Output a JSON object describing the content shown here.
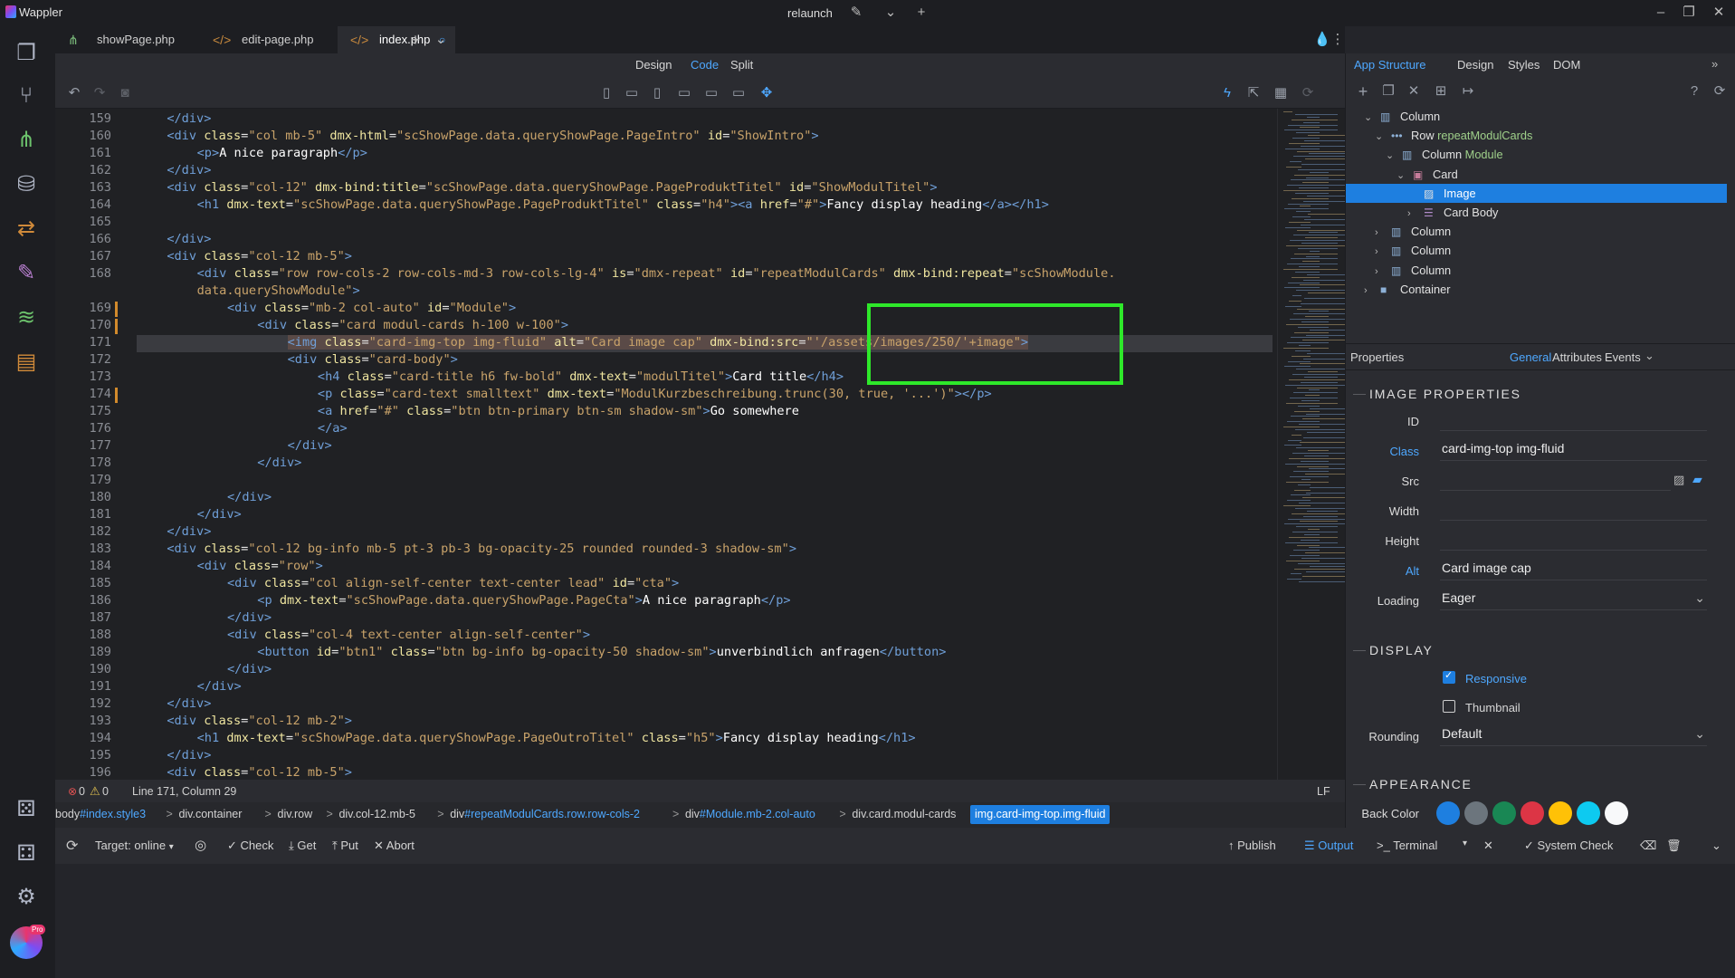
{
  "app": {
    "name": "Wappler",
    "project": "relaunch"
  },
  "tabs": [
    {
      "label": "showPage.php",
      "active": false
    },
    {
      "label": "edit-page.php",
      "active": false
    },
    {
      "label": "index.php",
      "active": true
    }
  ],
  "modes": {
    "design": "Design",
    "code": "Code",
    "split": "Split",
    "active": "Code"
  },
  "code_lines": [
    {
      "n": "159",
      "indent": 4,
      "html": "<span class='tg'>&lt;/div&gt;</span>"
    },
    {
      "n": "160",
      "indent": 4,
      "html": "<span class='tg'>&lt;div</span> <span class='at'>class</span>=<span class='sv'>\"col mb-5\"</span> <span class='at'>dmx-html</span>=<span class='sv'>\"scShowPage.data.queryShowPage.PageIntro\"</span> <span class='at'>id</span>=<span class='sv'>\"ShowIntro\"</span><span class='tg'>&gt;</span>"
    },
    {
      "n": "161",
      "indent": 8,
      "html": "<span class='tg'>&lt;p&gt;</span><span class='tx'>A nice paragraph</span><span class='tg'>&lt;/p&gt;</span>"
    },
    {
      "n": "162",
      "indent": 4,
      "html": "<span class='tg'>&lt;/div&gt;</span>"
    },
    {
      "n": "163",
      "indent": 4,
      "html": "<span class='tg'>&lt;div</span> <span class='at'>class</span>=<span class='sv'>\"col-12\"</span> <span class='at'>dmx-bind:title</span>=<span class='sv'>\"scShowPage.data.queryShowPage.PageProduktTitel\"</span> <span class='at'>id</span>=<span class='sv'>\"ShowModulTitel\"</span><span class='tg'>&gt;</span>"
    },
    {
      "n": "164",
      "indent": 8,
      "html": "<span class='tg'>&lt;h1</span> <span class='at'>dmx-text</span>=<span class='sv'>\"scShowPage.data.queryShowPage.PageProduktTitel\"</span> <span class='at'>class</span>=<span class='sv'>\"h4\"</span><span class='tg'>&gt;&lt;a</span> <span class='at'>href</span>=<span class='sv'>\"#\"</span><span class='tg'>&gt;</span><span class='tx'>Fancy display heading</span><span class='tg'>&lt;/a&gt;&lt;/h1&gt;</span>"
    },
    {
      "n": "165",
      "indent": 0,
      "html": ""
    },
    {
      "n": "166",
      "indent": 4,
      "html": "<span class='tg'>&lt;/div&gt;</span>"
    },
    {
      "n": "167",
      "indent": 4,
      "html": "<span class='tg'>&lt;div</span> <span class='at'>class</span>=<span class='sv'>\"col-12 mb-5\"</span><span class='tg'>&gt;</span>"
    },
    {
      "n": "168",
      "indent": 8,
      "html": "<span class='tg'>&lt;div</span> <span class='at'>class</span>=<span class='sv'>\"row row-cols-2 row-cols-md-3 row-cols-lg-4\"</span> <span class='at'>is</span>=<span class='sv'>\"dmx-repeat\"</span> <span class='at'>id</span>=<span class='sv'>\"repeatModulCards\"</span> <span class='at'>dmx-bind:repeat</span>=<span class='sv'>\"scShowModule.</span>"
    },
    {
      "n": "",
      "indent": 8,
      "html": "<span class='sv'>data.queryShowModule\"</span><span class='tg'>&gt;</span>"
    },
    {
      "n": "169",
      "indent": 12,
      "mod": true,
      "html": "<span class='tg'>&lt;div</span> <span class='at'>class</span>=<span class='sv'>\"mb-2 col-auto\"</span> <span class='at'>id</span>=<span class='sv'>\"Module\"</span><span class='tg'>&gt;</span>"
    },
    {
      "n": "170",
      "indent": 16,
      "mod": true,
      "html": "<span class='tg'>&lt;div</span> <span class='at'>class</span>=<span class='sv'>\"card modul-cards h-100 w-100\"</span><span class='tg'>&gt;</span>"
    },
    {
      "n": "171",
      "indent": 20,
      "current": true,
      "html": "<span class='sel'><span class='tg'>&lt;img</span> <span class='at'>class</span>=<span class='sv'>\"card-img-top img-fluid\"</span> <span class='at'>alt</span>=<span class='sv'>\"Card image cap\"</span> <span class='at'>dmx-bind:src</span>=<span class='sv'>\"'/assets/images/250/'+image\"</span><span class='tg'>&gt;</span></span>"
    },
    {
      "n": "172",
      "indent": 20,
      "html": "<span class='tg'>&lt;div</span> <span class='at'>class</span>=<span class='sv'>\"card-body\"</span><span class='tg'>&gt;</span>"
    },
    {
      "n": "173",
      "indent": 24,
      "html": "<span class='tg'>&lt;h4</span> <span class='at'>class</span>=<span class='sv'>\"card-title h6 fw-bold\"</span> <span class='at'>dmx-text</span>=<span class='sv'>\"modulTitel\"</span><span class='tg'>&gt;</span><span class='tx'>Card title</span><span class='tg'>&lt;/h4&gt;</span>"
    },
    {
      "n": "174",
      "indent": 24,
      "mod": true,
      "html": "<span class='tg'>&lt;p</span> <span class='at'>class</span>=<span class='sv'>\"card-text smalltext\"</span> <span class='at'>dmx-text</span>=<span class='sv'>\"ModulKurzbeschreibung.trunc(30, true, '...')\"</span><span class='tg'>&gt;&lt;/p&gt;</span>"
    },
    {
      "n": "175",
      "indent": 24,
      "html": "<span class='tg'>&lt;a</span> <span class='at'>href</span>=<span class='sv'>\"#\"</span> <span class='at'>class</span>=<span class='sv'>\"btn btn-primary btn-sm shadow-sm\"</span><span class='tg'>&gt;</span><span class='tx'>Go somewhere</span>"
    },
    {
      "n": "176",
      "indent": 24,
      "html": "<span class='tg'>&lt;/a&gt;</span>"
    },
    {
      "n": "177",
      "indent": 20,
      "html": "<span class='tg'>&lt;/div&gt;</span>"
    },
    {
      "n": "178",
      "indent": 16,
      "html": "<span class='tg'>&lt;/div&gt;</span>"
    },
    {
      "n": "179",
      "indent": 0,
      "html": ""
    },
    {
      "n": "180",
      "indent": 12,
      "html": "<span class='tg'>&lt;/div&gt;</span>"
    },
    {
      "n": "181",
      "indent": 8,
      "html": "<span class='tg'>&lt;/div&gt;</span>"
    },
    {
      "n": "182",
      "indent": 4,
      "html": "<span class='tg'>&lt;/div&gt;</span>"
    },
    {
      "n": "183",
      "indent": 4,
      "html": "<span class='tg'>&lt;div</span> <span class='at'>class</span>=<span class='sv'>\"col-12 bg-info mb-5 pt-3 pb-3 bg-opacity-25 rounded rounded-3 shadow-sm\"</span><span class='tg'>&gt;</span>"
    },
    {
      "n": "184",
      "indent": 8,
      "html": "<span class='tg'>&lt;div</span> <span class='at'>class</span>=<span class='sv'>\"row\"</span><span class='tg'>&gt;</span>"
    },
    {
      "n": "185",
      "indent": 12,
      "html": "<span class='tg'>&lt;div</span> <span class='at'>class</span>=<span class='sv'>\"col align-self-center text-center lead\"</span> <span class='at'>id</span>=<span class='sv'>\"cta\"</span><span class='tg'>&gt;</span>"
    },
    {
      "n": "186",
      "indent": 16,
      "html": "<span class='tg'>&lt;p</span> <span class='at'>dmx-text</span>=<span class='sv'>\"scShowPage.data.queryShowPage.PageCta\"</span><span class='tg'>&gt;</span><span class='tx'>A nice paragraph</span><span class='tg'>&lt;/p&gt;</span>"
    },
    {
      "n": "187",
      "indent": 12,
      "html": "<span class='tg'>&lt;/div&gt;</span>"
    },
    {
      "n": "188",
      "indent": 12,
      "html": "<span class='tg'>&lt;div</span> <span class='at'>class</span>=<span class='sv'>\"col-4 text-center align-self-center\"</span><span class='tg'>&gt;</span>"
    },
    {
      "n": "189",
      "indent": 16,
      "html": "<span class='tg'>&lt;button</span> <span class='at'>id</span>=<span class='sv'>\"btn1\"</span> <span class='at'>class</span>=<span class='sv'>\"btn bg-info bg-opacity-50 shadow-sm\"</span><span class='tg'>&gt;</span><span class='tx'>unverbindlich anfragen</span><span class='tg'>&lt;/button&gt;</span>"
    },
    {
      "n": "190",
      "indent": 12,
      "html": "<span class='tg'>&lt;/div&gt;</span>"
    },
    {
      "n": "191",
      "indent": 8,
      "html": "<span class='tg'>&lt;/div&gt;</span>"
    },
    {
      "n": "192",
      "indent": 4,
      "html": "<span class='tg'>&lt;/div&gt;</span>"
    },
    {
      "n": "193",
      "indent": 4,
      "html": "<span class='tg'>&lt;div</span> <span class='at'>class</span>=<span class='sv'>\"col-12 mb-2\"</span><span class='tg'>&gt;</span>"
    },
    {
      "n": "194",
      "indent": 8,
      "html": "<span class='tg'>&lt;h1</span> <span class='at'>dmx-text</span>=<span class='sv'>\"scShowPage.data.queryShowPage.PageOutroTitel\"</span> <span class='at'>class</span>=<span class='sv'>\"h5\"</span><span class='tg'>&gt;</span><span class='tx'>Fancy display heading</span><span class='tg'>&lt;/h1&gt;</span>"
    },
    {
      "n": "195",
      "indent": 4,
      "html": "<span class='tg'>&lt;/div&gt;</span>"
    },
    {
      "n": "196",
      "indent": 4,
      "html": "<span class='tg'>&lt;div</span> <span class='at'>class</span>=<span class='sv'>\"col-12 mb-5\"</span><span class='tg'>&gt;</span>"
    }
  ],
  "status": {
    "errors": "0",
    "warnings": "0",
    "position": "Line 171, Column 29",
    "eol": "LF"
  },
  "breadcrumb": [
    {
      "pre": "body",
      "blue": "#index.style3",
      "post": ""
    },
    {
      "pre": "div.container",
      "blue": "",
      "post": ""
    },
    {
      "pre": "div.row",
      "blue": "",
      "post": ""
    },
    {
      "pre": "div.col-12.mb-5",
      "blue": "",
      "post": ""
    },
    {
      "pre": "div",
      "blue": "#repeatModulCards.row.row-cols-2",
      "post": ""
    },
    {
      "pre": "div",
      "blue": "#Module.mb-2.col-auto",
      "post": ""
    },
    {
      "pre": "div.card.modul-cards",
      "blue": "",
      "post": ""
    }
  ],
  "breadcrumb_active": "img.card-img-top.img-fluid",
  "bottom": {
    "target": "Target: online",
    "check": "Check",
    "get": "Get",
    "put": "Put",
    "abort": "Abort",
    "publish": "Publish",
    "output": "Output",
    "terminal": "Terminal",
    "system_check": "System Check"
  },
  "right_tabs": {
    "app_structure": "App Structure",
    "design": "Design",
    "styles": "Styles",
    "dom": "DOM"
  },
  "tree": [
    {
      "label": "Column",
      "prefix": "",
      "depth": 1,
      "chev": "v",
      "icon": "column"
    },
    {
      "label": "repeatModulCards",
      "prefix": "Row ",
      "depth": 2,
      "chev": "v",
      "icon": "dots"
    },
    {
      "label": "Module",
      "prefix": "Column ",
      "depth": 3,
      "chev": "v",
      "icon": "column"
    },
    {
      "label": "Card",
      "prefix": "",
      "depth": 4,
      "chev": "v",
      "icon": "card"
    },
    {
      "label": "Image",
      "prefix": "",
      "depth": 5,
      "chev": "",
      "icon": "image",
      "selected": true
    },
    {
      "label": "Card Body",
      "prefix": "",
      "depth": 5,
      "chev": ">",
      "icon": "lines"
    },
    {
      "label": "Column",
      "prefix": "",
      "depth": 2,
      "chev": ">",
      "icon": "column"
    },
    {
      "label": "Column",
      "prefix": "",
      "depth": 2,
      "chev": ">",
      "icon": "column"
    },
    {
      "label": "Column",
      "prefix": "",
      "depth": 2,
      "chev": ">",
      "icon": "column"
    },
    {
      "label": "Container",
      "prefix": "",
      "depth": 1,
      "chev": ">",
      "icon": "container"
    }
  ],
  "properties": {
    "title": "Properties",
    "tabs": {
      "general": "General",
      "attributes": "Attributes",
      "events": "Events"
    },
    "image_section": "IMAGE PROPERTIES",
    "id_label": "ID",
    "id_value": "",
    "class_label": "Class",
    "class_value": "card-img-top img-fluid",
    "src_label": "Src",
    "src_value": "",
    "width_label": "Width",
    "width_value": "",
    "height_label": "Height",
    "height_value": "",
    "alt_label": "Alt",
    "alt_value": "Card image cap",
    "loading_label": "Loading",
    "loading_value": "Eager",
    "display_section": "DISPLAY",
    "responsive_label": "Responsive",
    "responsive_checked": true,
    "thumbnail_label": "Thumbnail",
    "thumbnail_checked": false,
    "rounding_label": "Rounding",
    "rounding_value": "Default",
    "appearance_section": "APPEARANCE",
    "backcolor_label": "Back Color",
    "back_colors": [
      "#1e7fe0",
      "#6c757d",
      "#198754",
      "#dc3545",
      "#ffc107",
      "#0dcaf0",
      "#f8f9fa"
    ]
  },
  "pro_badge": "Pro"
}
